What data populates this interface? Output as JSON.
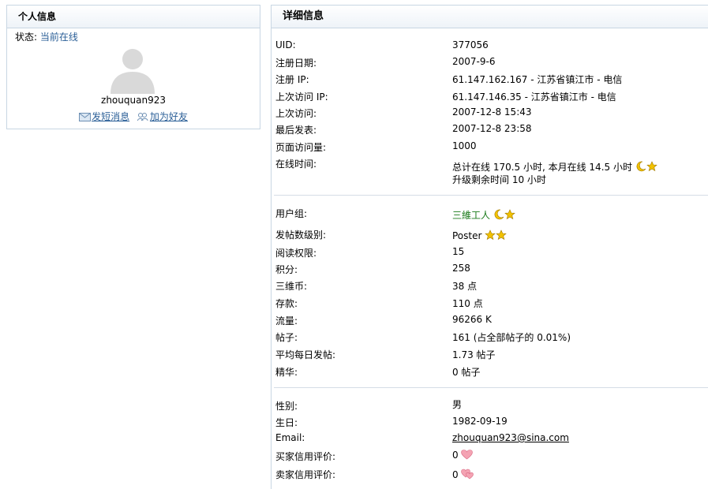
{
  "left": {
    "title": "个人信息",
    "status_label": "状态:",
    "status_value": "当前在线",
    "username": "zhouquan923",
    "send_message": "发短消息",
    "add_friend": "加为好友"
  },
  "right": {
    "title": "详细信息",
    "section1": [
      {
        "label": "UID:",
        "value": "377056"
      },
      {
        "label": "注册日期:",
        "value": "2007-9-6"
      },
      {
        "label": "注册 IP:",
        "value": "61.147.162.167 - 江苏省镇江市  - 电信"
      },
      {
        "label": "上次访问 IP:",
        "value": "61.147.146.35 - 江苏省镇江市  - 电信"
      },
      {
        "label": "上次访问:",
        "value": "2007-12-8 15:43"
      },
      {
        "label": "最后发表:",
        "value": "2007-12-8 23:58"
      },
      {
        "label": "页面访问量:",
        "value": "1000"
      },
      {
        "label": "在线时间:",
        "value": "总计在线  170.5 小时, 本月在线  14.5 小时",
        "value2": "升级剩余时间  10 小时"
      }
    ],
    "section2": [
      {
        "label": "用户组:",
        "value": "三維工人"
      },
      {
        "label": "发帖数级别:",
        "value": "Poster"
      },
      {
        "label": "阅读权限:",
        "value": "15"
      },
      {
        "label": "积分:",
        "value": "258"
      },
      {
        "label": "三维币:",
        "value": "38 点"
      },
      {
        "label": "存款:",
        "value": "110 点"
      },
      {
        "label": "流量:",
        "value": "96266 K"
      },
      {
        "label": "帖子:",
        "value": "161 (占全部帖子的  0.01%)"
      },
      {
        "label": "平均每日发帖:",
        "value": "1.73 帖子"
      },
      {
        "label": "精华:",
        "value": "0 帖子"
      }
    ],
    "section3": [
      {
        "label": "性别:",
        "value": "男"
      },
      {
        "label": "生日:",
        "value": "1982-09-19"
      },
      {
        "label": "Email:",
        "value": "zhouquan923@sina.com"
      },
      {
        "label": "买家信用评价:",
        "value": "0"
      },
      {
        "label": "卖家信用评价:",
        "value": "0"
      }
    ]
  },
  "colors": {
    "link": "#2b5f97",
    "group": "#1a7a1a",
    "border": "#c8d6e3",
    "star": "#f2c200",
    "heart": "#f08aa0"
  },
  "icons": [
    "moon-icon",
    "star-icon",
    "heart-icon",
    "message-icon",
    "add-friend-icon",
    "avatar-placeholder"
  ]
}
